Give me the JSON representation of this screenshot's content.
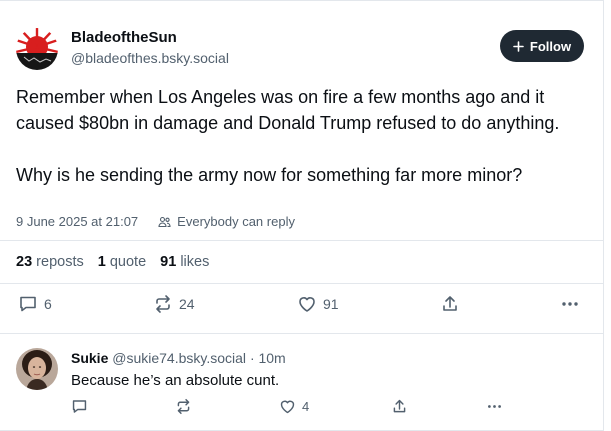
{
  "post": {
    "author_name": "BladeoftheSun",
    "author_handle": "@bladeofthes.bsky.social",
    "follow_label": "Follow",
    "body": "Remember when Los Angeles was on fire a few months ago and it caused $80bn in damage and Donald Trump refused to do anything.\n\nWhy is he sending the army now for something far more minor?",
    "timestamp": "9 June 2025 at 21:07",
    "reply_permission": "Everybody can reply",
    "stats": {
      "reposts_count": "23",
      "reposts_label": "reposts",
      "quotes_count": "1",
      "quotes_label": "quote",
      "likes_count": "91",
      "likes_label": "likes"
    },
    "actions": {
      "reply_count": "6",
      "repost_count": "24",
      "like_count": "91"
    }
  },
  "reply": {
    "author_name": "Sukie",
    "author_handle": "@sukie74.bsky.social",
    "time": "· 10m",
    "text": "Because he’s an absolute cunt.",
    "actions": {
      "like_count": "4"
    }
  },
  "icons": {
    "follow": "plus-icon",
    "reply": "speech-bubble-icon",
    "repost": "repost-arrows-icon",
    "like": "heart-icon",
    "share": "share-upload-icon",
    "more": "ellipsis-icon",
    "reply_permission": "people-icon"
  },
  "colors": {
    "follow_button_bg": "#1f2933",
    "muted_text": "#52606e",
    "divider": "#e3e7ec"
  }
}
